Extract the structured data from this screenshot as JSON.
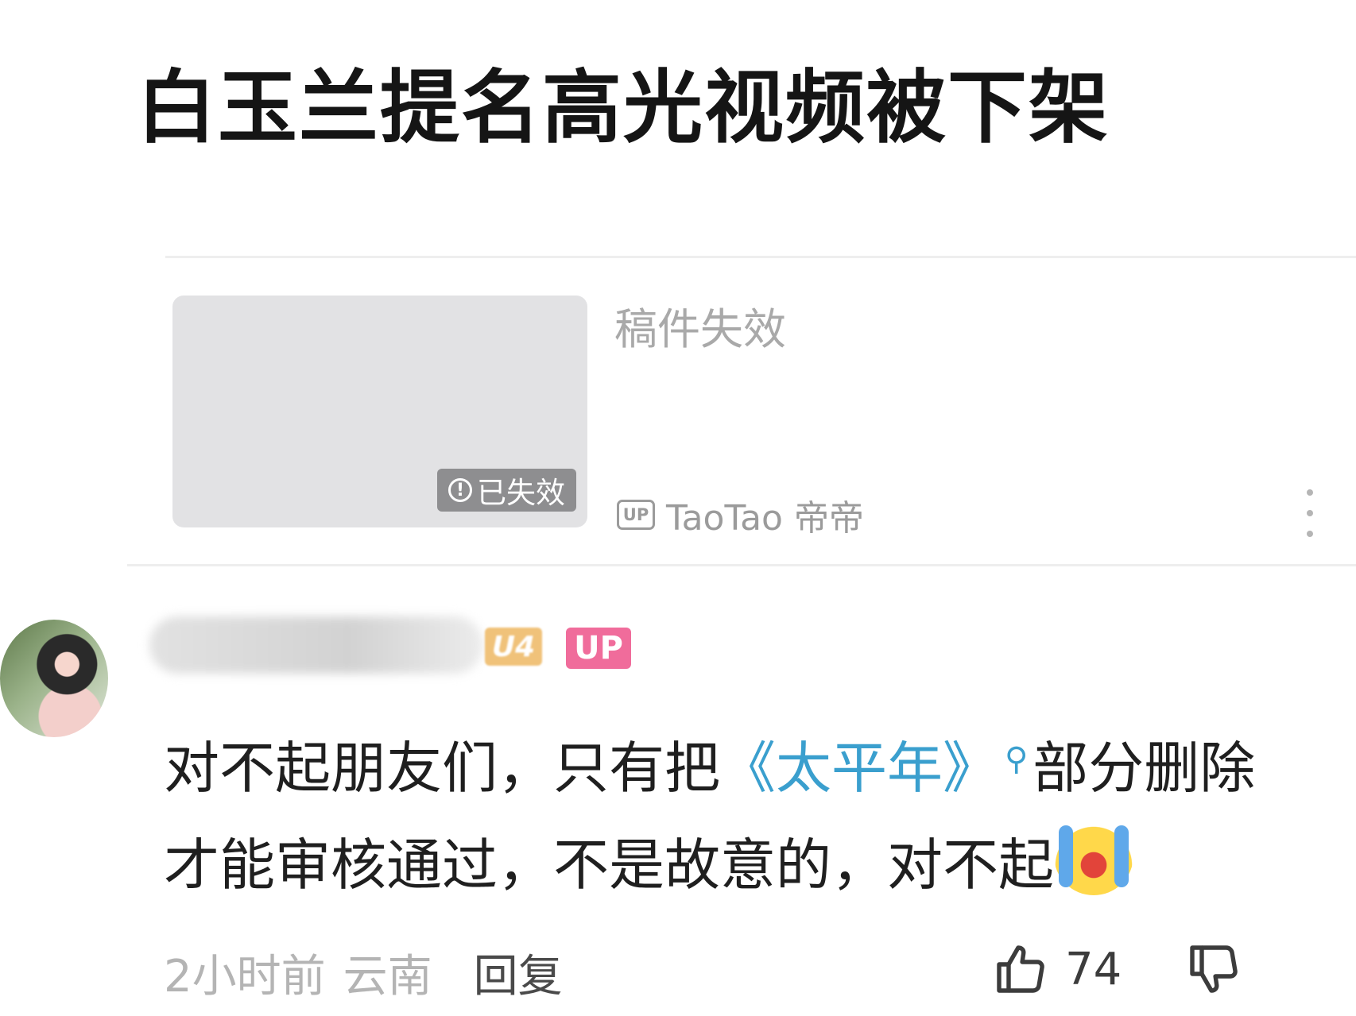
{
  "headline": "白玉兰提名高光视频被下架",
  "video_card": {
    "title": "稿件失效",
    "invalid_badge": "已失效",
    "up_label": "UP",
    "uploader_name": "TaoTao 帝帝"
  },
  "comment": {
    "level_badge": "U4",
    "up_badge": "UP",
    "text_before_topic": "对不起朋友们，只有把",
    "topic": "《太平年》",
    "text_after_topic": "部分删除才能审核通过，不是故意的，对不起",
    "emoji": "crying-emoji",
    "time": "2小时前",
    "location": "云南",
    "reply_label": "回复",
    "like_count": "74"
  }
}
